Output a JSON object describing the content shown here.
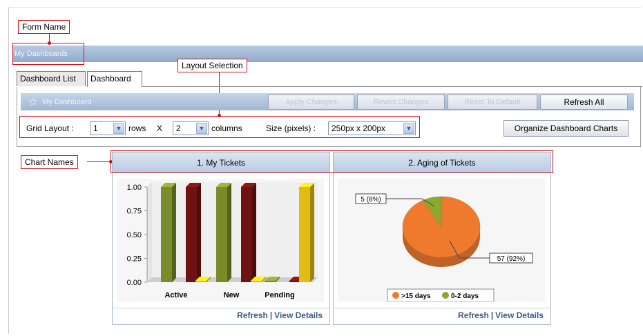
{
  "annotations": {
    "form_name": "Form Name",
    "layout_selection": "Layout Selection",
    "chart_names": "Chart Names"
  },
  "window": {
    "title": "My Dashboards"
  },
  "tabs": [
    {
      "label": "Dashboard List",
      "active": false
    },
    {
      "label": "Dashboard",
      "active": true
    }
  ],
  "dashboard_bar": {
    "title": "My Dashboard",
    "icon": "magic-wand-icon",
    "buttons": {
      "apply": {
        "label": "Apply Changes",
        "enabled": false
      },
      "revert": {
        "label": "Revert Changes",
        "enabled": false
      },
      "reset": {
        "label": "Reset To Default",
        "enabled": false
      },
      "refresh_all": {
        "label": "Refresh All",
        "enabled": true
      }
    }
  },
  "layout_controls": {
    "grid_label": "Grid Layout :",
    "rows_value": "1",
    "rows_label": "rows",
    "times": "X",
    "cols_value": "2",
    "cols_label": "columns",
    "size_label": "Size (pixels) :",
    "size_value": "250px x 200px",
    "organize_label": "Organize Dashboard Charts"
  },
  "colors": {
    "green": "#7a8c2a",
    "maroon": "#6e1212",
    "yellow": "#e2bc10",
    "orange": "#ef7a2e",
    "pie_green": "#8ca830",
    "annotation_red": "#d01018",
    "link_blue": "#3a5b8a"
  },
  "charts": [
    {
      "title": "1. My Tickets",
      "links": {
        "refresh": "Refresh",
        "sep": "|",
        "details": "View Details"
      }
    },
    {
      "title": "2. Aging of Tickets",
      "links": {
        "refresh": "Refresh",
        "sep": "|",
        "details": "View Details"
      }
    }
  ],
  "chart_data": [
    {
      "type": "bar",
      "title": "1. My Tickets",
      "categories": [
        "Active",
        "New",
        "Pending"
      ],
      "series": [
        {
          "color": "#7a8c2a",
          "values": [
            1,
            1,
            0
          ]
        },
        {
          "color": "#6e1212",
          "values": [
            1,
            1,
            0
          ]
        },
        {
          "color": "#e2bc10",
          "values": [
            0,
            0,
            1
          ]
        }
      ],
      "yticks": [
        "0.00",
        "0.25",
        "0.50",
        "0.75",
        "1.00"
      ],
      "ylim": [
        0,
        1
      ],
      "style": "3d"
    },
    {
      "type": "pie",
      "title": "2. Aging of Tickets",
      "slices": [
        {
          "label": ">15 days",
          "value": 57,
          "percent": 92,
          "color": "#ef7a2e",
          "callout": "57 (92%)"
        },
        {
          "label": "0-2 days",
          "value": 5,
          "percent": 8,
          "color": "#8ca830",
          "callout": "5 (8%)"
        }
      ],
      "legend_position": "bottom",
      "style": "3d"
    }
  ]
}
